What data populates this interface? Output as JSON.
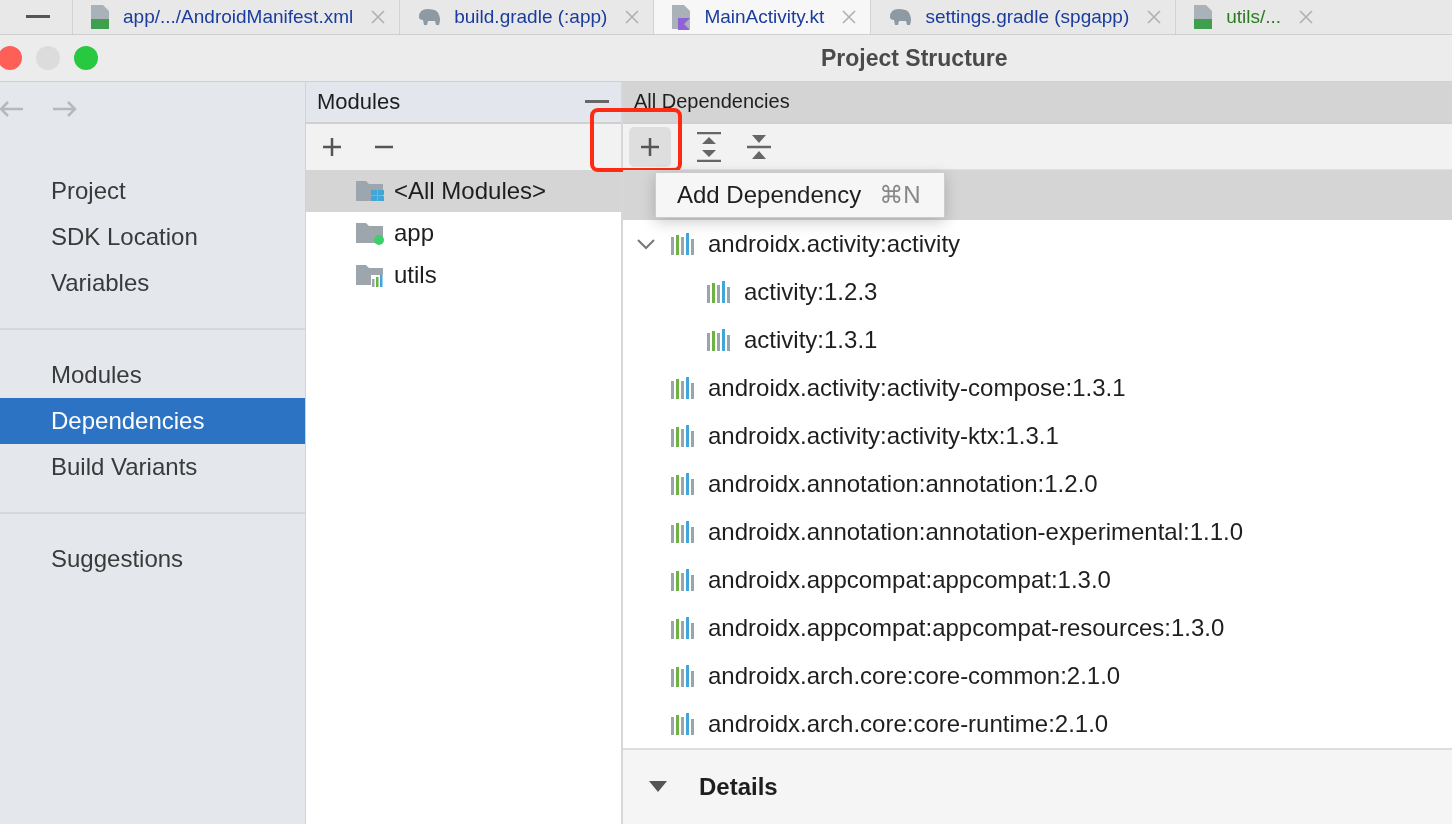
{
  "tabs": [
    {
      "label": "app/.../AndroidManifest.xml",
      "kind": "manifest",
      "selected": false,
      "color": "#1a3c9e"
    },
    {
      "label": "build.gradle (:app)",
      "kind": "gradle",
      "selected": false,
      "color": "#1a3c9e"
    },
    {
      "label": "MainActivity.kt",
      "kind": "kotlin",
      "selected": true,
      "color": "#1a3c9e"
    },
    {
      "label": "settings.gradle (spgapp)",
      "kind": "gradle",
      "selected": false,
      "color": "#1a3c9e"
    },
    {
      "label": "utils/...",
      "kind": "manifest",
      "selected": false,
      "color": "#2a7d1f"
    }
  ],
  "window": {
    "title": "Project Structure"
  },
  "sidebar": {
    "groups": [
      [
        {
          "label": "Project",
          "selected": false
        },
        {
          "label": "SDK Location",
          "selected": false
        },
        {
          "label": "Variables",
          "selected": false
        }
      ],
      [
        {
          "label": "Modules",
          "selected": false
        },
        {
          "label": "Dependencies",
          "selected": true
        },
        {
          "label": "Build Variants",
          "selected": false
        }
      ],
      [
        {
          "label": "Suggestions",
          "selected": false
        }
      ]
    ]
  },
  "modules": {
    "title": "Modules",
    "items": [
      {
        "label": "<All Modules>",
        "kind": "all",
        "selected": true
      },
      {
        "label": "app",
        "kind": "app",
        "selected": false
      },
      {
        "label": "utils",
        "kind": "library",
        "selected": false
      }
    ]
  },
  "dependencies": {
    "title": "All Dependencies",
    "hidden_row_selected": true,
    "items": [
      {
        "label": "androidx.activity:activity",
        "expanded": true,
        "children": [
          {
            "label": "activity:1.2.3"
          },
          {
            "label": "activity:1.3.1"
          }
        ]
      },
      {
        "label": "androidx.activity:activity-compose:1.3.1"
      },
      {
        "label": "androidx.activity:activity-ktx:1.3.1"
      },
      {
        "label": "androidx.annotation:annotation:1.2.0"
      },
      {
        "label": "androidx.annotation:annotation-experimental:1.1.0"
      },
      {
        "label": "androidx.appcompat:appcompat:1.3.0"
      },
      {
        "label": "androidx.appcompat:appcompat-resources:1.3.0"
      },
      {
        "label": "androidx.arch.core:core-common:2.1.0"
      },
      {
        "label": "androidx.arch.core:core-runtime:2.1.0"
      }
    ]
  },
  "popup_menu": {
    "items": [
      {
        "label": "Add Dependency",
        "shortcut": "⌘N"
      }
    ]
  },
  "details": {
    "title": "Details"
  }
}
